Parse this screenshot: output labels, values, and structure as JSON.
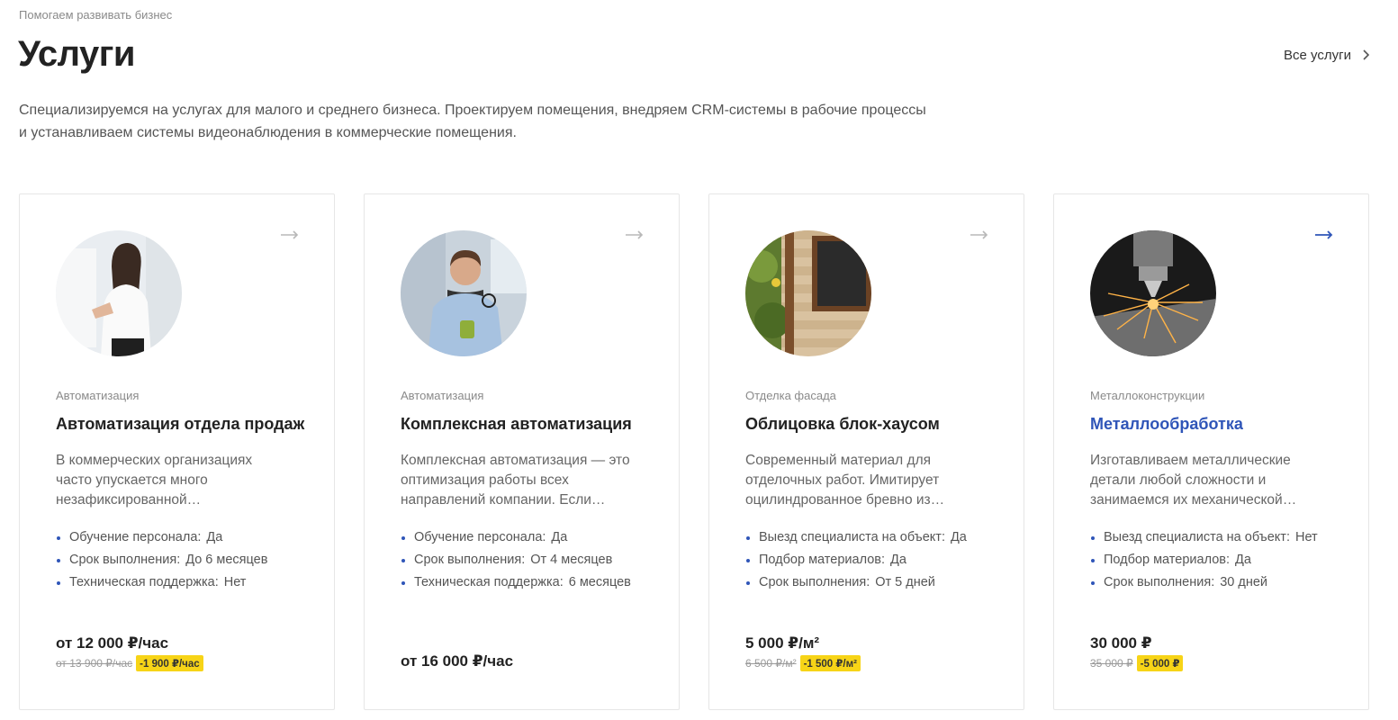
{
  "header": {
    "eyebrow": "Помогаем развивать бизнес",
    "title": "Услуги",
    "all_services_label": "Все услуги",
    "intro": "Специализируемся на услугах для малого и среднего бизнеса. Проектируем помещения, внедряем CRM-системы в рабочие процессы и устанавливаем системы видеонаблюдения в коммерческие помещения."
  },
  "colors": {
    "accent": "#2f55b8",
    "discount_badge": "#f7d417"
  },
  "cards": [
    {
      "category": "Автоматизация",
      "title": "Автоматизация отдела продаж",
      "description": "В коммерческих организациях часто упускается много незафиксированной…",
      "features": [
        {
          "label": "Обучение персонала",
          "value": "Да"
        },
        {
          "label": "Срок выполнения",
          "value": "До 6 месяцев"
        },
        {
          "label": "Техническая поддержка",
          "value": "Нет"
        }
      ],
      "price": "от 12 000 ₽/час",
      "old_price": "от 13 900 ₽/час",
      "discount": "-1 900 ₽/час",
      "image": "woman-presenting-photo"
    },
    {
      "category": "Автоматизация",
      "title": "Комплексная автоматизация",
      "description": "Комплексная автоматизация — это оптимизация работы всех направлений компании. Если…",
      "features": [
        {
          "label": "Обучение персонала",
          "value": "Да"
        },
        {
          "label": "Срок выполнения",
          "value": "От 4 месяцев"
        },
        {
          "label": "Техническая поддержка",
          "value": "6 месяцев"
        }
      ],
      "price": "от 16 000 ₽/час",
      "image": "man-with-cup-photo"
    },
    {
      "category": "Отделка фасада",
      "title": "Облицовка блок-хаусом",
      "description": "Современный материал для отделочных работ. Имитирует оцилиндрованное бревно из…",
      "features": [
        {
          "label": "Выезд специалиста на объект",
          "value": "Да"
        },
        {
          "label": "Подбор материалов",
          "value": "Да"
        },
        {
          "label": "Срок выполнения",
          "value": "От 5 дней"
        }
      ],
      "price": "5 000 ₽/м²",
      "old_price": "6 500 ₽/м²",
      "discount": "-1 500 ₽/м²",
      "image": "wooden-facade-photo"
    },
    {
      "category": "Металлоконструкции",
      "title": "Металлообработка",
      "description": "Изготавливаем металлические детали любой сложности и занимаемся их механической…",
      "features": [
        {
          "label": "Выезд специалиста на объект",
          "value": "Нет"
        },
        {
          "label": "Подбор материалов",
          "value": "Да"
        },
        {
          "label": "Срок выполнения",
          "value": "30 дней"
        }
      ],
      "price": "30 000 ₽",
      "old_price": "35 000 ₽",
      "discount": "-5 000 ₽",
      "image": "metal-cutting-sparks-photo",
      "state": "hover"
    }
  ]
}
